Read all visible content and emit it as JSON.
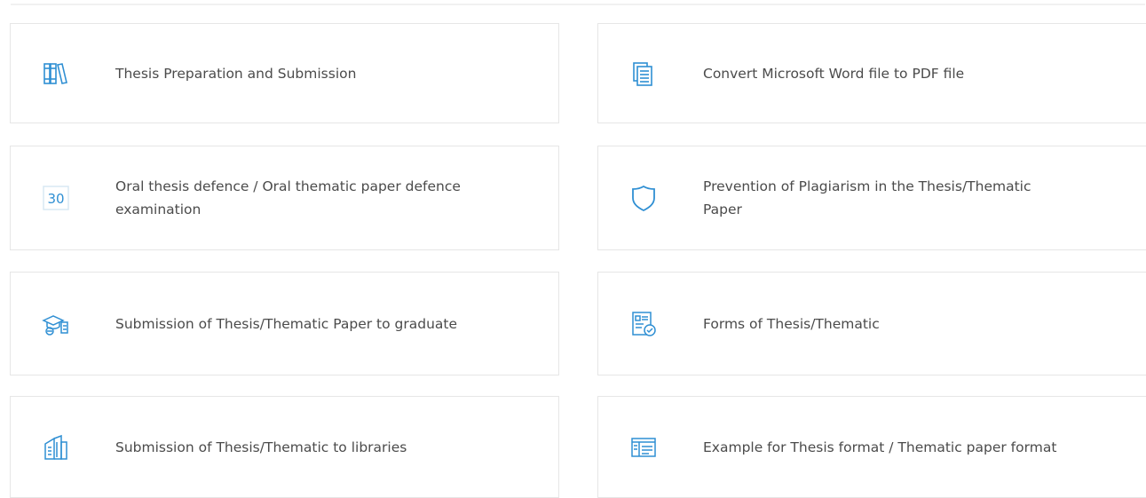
{
  "accent_color": "#2f8fd3",
  "cards": [
    {
      "label": "Thesis Preparation and Submission",
      "icon": "books-icon"
    },
    {
      "label": "Convert Microsoft Word file to PDF file",
      "icon": "documents-icon"
    },
    {
      "label": "Oral thesis defence / Oral thematic paper defence examination",
      "icon": "calendar-icon",
      "icon_text": "30"
    },
    {
      "label": "Prevention of Plagiarism in the Thesis/Thematic Paper",
      "icon": "shield-icon"
    },
    {
      "label": "Submission of Thesis/Thematic Paper to graduate",
      "icon": "graduation-cap-icon"
    },
    {
      "label": "Forms of Thesis/Thematic",
      "icon": "form-check-icon"
    },
    {
      "label": "Submission of Thesis/Thematic to libraries",
      "icon": "library-building-icon"
    },
    {
      "label": "Example for Thesis format / Thematic paper format",
      "icon": "format-layout-icon"
    }
  ]
}
